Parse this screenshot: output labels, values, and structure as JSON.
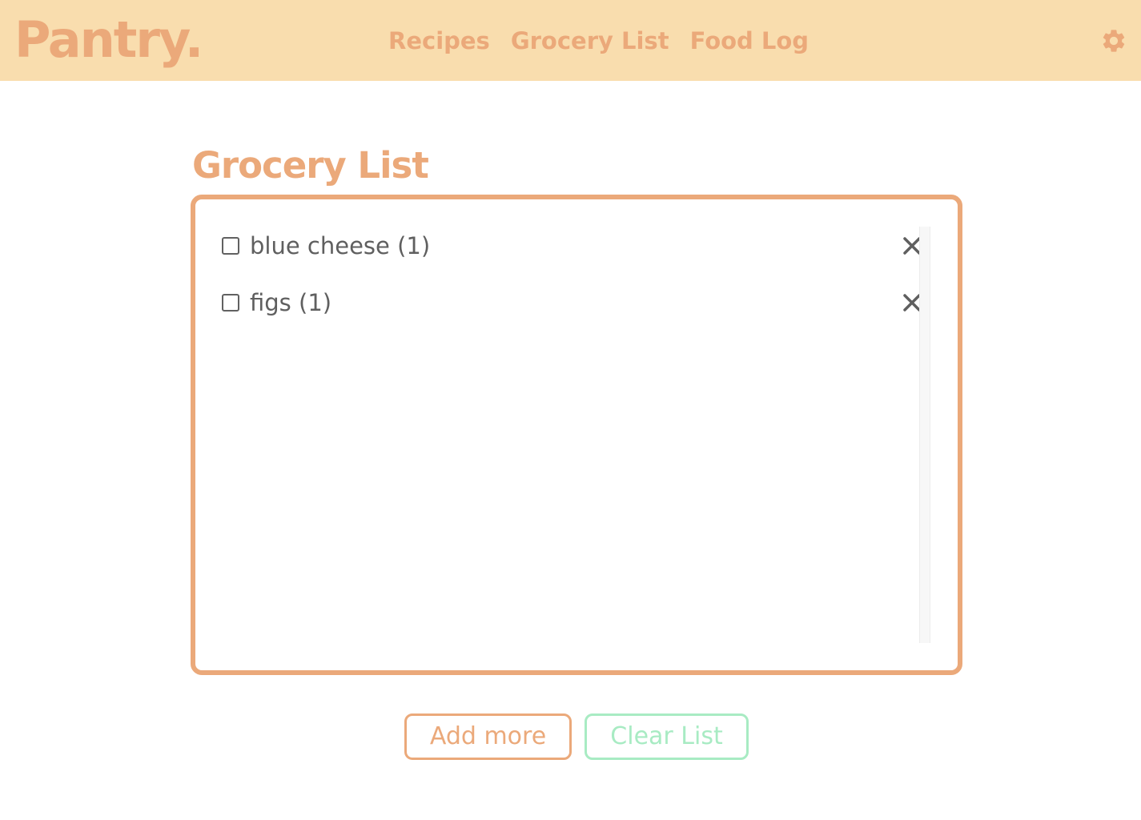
{
  "app": {
    "logo": "Pantry."
  },
  "nav": {
    "links": [
      "Recipes",
      "Grocery List",
      "Food Log"
    ]
  },
  "header": {
    "settings_icon": "gear-icon"
  },
  "page": {
    "title": "Grocery List"
  },
  "grocery_list": {
    "items": [
      {
        "label": "blue cheese (1)",
        "checked": false
      },
      {
        "label": "figs (1)",
        "checked": false
      }
    ]
  },
  "actions": {
    "add_label": "Add more",
    "clear_label": "Clear List"
  },
  "colors": {
    "accent": "#eba97a",
    "header_bg": "#f9ddae",
    "secondary": "#a8ebc3",
    "text": "#5f5f5f"
  }
}
